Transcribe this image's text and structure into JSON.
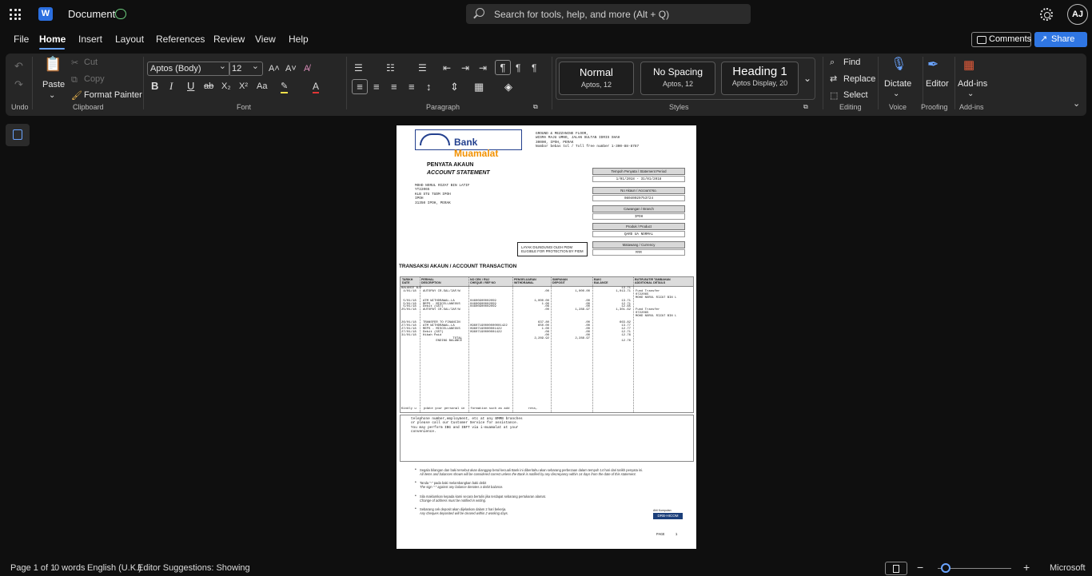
{
  "titlebar": {
    "doc_title": "Document",
    "search_placeholder": "Search for tools, help, and more (Alt + Q)",
    "avatar_initials": "AJ"
  },
  "menu": {
    "items": [
      "File",
      "Home",
      "Insert",
      "Layout",
      "References",
      "Review",
      "View",
      "Help"
    ],
    "active": "Home",
    "comments": "Comments",
    "share": "Share"
  },
  "ribbon": {
    "clipboard": {
      "paste": "Paste",
      "cut": "Cut",
      "copy": "Copy",
      "format_painter": "Format Painter",
      "label": "Clipboard"
    },
    "undo_label": "Undo",
    "font": {
      "name": "Aptos (Body)",
      "size": "12",
      "label": "Font"
    },
    "paragraph_label": "Paragraph",
    "styles": {
      "label": "Styles",
      "cards": [
        {
          "name": "Normal",
          "sub": "Aptos, 12"
        },
        {
          "name": "No Spacing",
          "sub": "Aptos, 12"
        },
        {
          "name": "Heading 1",
          "sub": "Aptos Display, 20"
        }
      ]
    },
    "editing": {
      "find": "Find",
      "replace": "Replace",
      "select": "Select",
      "label": "Editing"
    },
    "voice": {
      "dictate": "Dictate",
      "label": "Voice"
    },
    "proofing": {
      "editor": "Editor",
      "label": "Proofing"
    },
    "addins": {
      "addins": "Add-ins",
      "label": "Add-ins"
    }
  },
  "document": {
    "logo_text": "Bank Muamalat",
    "bank_address": "GROUND & MEZZANINE FLOOR,\nWISMA MAJU UMNO, JALAN SULTAN IDRIS SHAH\n30000, IPOH, PERAK\nNombor bebas tol / Toll free number 1-300-88-8787",
    "statement_title_ms": "PENYATA AKAUN",
    "statement_title_en": "ACCOUNT STATEMENT",
    "customer_address": "MOHD NORUL RIZAT BIN LATIF\nYT22065\nKLB STU TUDM IPOH\nIPOH\n31350 IPOH, PERAK",
    "info_boxes": [
      {
        "label": "Tempoh Penyata / Statement Period",
        "value": "1/01/2018 - 31/01/2018"
      },
      {
        "label": "No Akaun / Account No.",
        "value": "08040029753724"
      },
      {
        "label": "Cawangan / Branch",
        "value": "IPOH"
      },
      {
        "label": "Produk / Product",
        "value": "QARD UA NORMAL"
      },
      {
        "label": "Matawang / Currency",
        "value": "MYR"
      }
    ],
    "pidm_text": "LAYAK DILINDUNGI OLEH PIDM\nELIGIBLE FOR PROTECTION BY PIDM",
    "tx_title": "TRANSAKSI AKAUN / ACCOUNT TRANSACTION",
    "tx_headers": [
      "TARIKH\nDATE",
      "PERIHAL\nDESCRIPTION",
      "NO CEK / RUJ\nCHEQUE / REF NO",
      "PENGELUARAN\nWITHDRAWAL",
      "SIMPANAN\nDEPOSIT",
      "BAKI\nBALANCE",
      "BUTIR-BUTIR TAMBAHAN\nADDITIONAL DETAILS"
    ],
    "tx_dates": "BALANCE B/F\n 4/01/18\n\n\n 5/01/18\n 5/01/18\n 5/01/18\n25/01/18\n\n\n\n26/01/18\n27/01/18\n27/01/18\n27/01/18\n31/01/18",
    "tx_desc": "\nAUTOPAY CR-SAL/IAF/W\n\n\nATM WITHDRAWAL-LA\nMEPS - MISCELLANEOUS\nDebit (GST)\nAUTOPAY CR-SAL/IAF/W\n\n\n\nTRANSFER TO FINANCIN\nATM WITHDRAWAL-LA\nMEPS - MISCELLANEOUS\nDebit (GST)\nHibah Paid\n                TOTAL\n       ENDING BALANCE",
    "tx_ref": "\n\n\n\n04600900002059\n04600900002059\n04600900002059\n\n\n\n\n\n09607190000000001422\n09607190000001422\n09607190000001422",
    "tx_withdrawal": "\n.00\n\n\n1,000.00\n1.00\n.06\n.00\n\n\n\n637.80\n650.00\n1.00\n.06\n.00\n2,289.92",
    "tx_deposit": "\n1,000.00\n\n\n.00\n.00\n.00\n1,288.97\n\n\n\n.00\n.00\n.00\n.00\n.00\n2,288.97",
    "tx_balance": "13.71\n1,013.71\n\n\n13.71\n12.71\n12.65\n1,301.62\n\n\n\n663.82\n13.77\n12.77\n12.71\n12.76\n\n12.76",
    "tx_details": "\nFund Transfer\n0722065\nMOHD NORUL RIZAT BIN L\n\n\n\nFund Transfer\n0722065\nMOHD NORUL RIZAT BIN L",
    "tx_footer": "Kindly u    pdate your personal in   formation such as add          ress,",
    "notice_text": "telephone number,employment, etc at any BMMB branches\nor please call our Customer Service for assistance.\nYou may perform IBG and IBFT via i-muamalat at your\nconvenience.",
    "bullets": [
      {
        "ms": "Segala bilangan dan baki tersebut akan dianggap betul kecuali Bank ini diberitahu akan sebarang perbezaan dalam tempoh 14 hari dari tarikh penyata ini.",
        "en": "All items and balances shown will be considered correct unless the Bank is notified by any discrepancy within 14 days from the date of this statement."
      },
      {
        "ms": "Tanda \"-\" pada baki melambangkan baki debit",
        "en": "The sign \"-\" against any balance denotes a debit balance."
      },
      {
        "ms": "Sila maklumkan kepada kami secara bertulis jika terdapat sebarang pertukaran alamat.",
        "en": "Change of address must be notified in writing."
      },
      {
        "ms": "Sebarang cek deposit akan dijelaskan dalam 2 hari bekerja.",
        "en": "Any cheques deposited will be cleared within 2 working days."
      }
    ],
    "group_caption": "DRB-HICOM",
    "group_small": "Ahli Kumpulan",
    "page_label": "PAGE     1"
  },
  "status": {
    "page": "Page 1 of 1",
    "words": "0 words",
    "language": "English (U.K.)",
    "editor": "Editor Suggestions: Showing",
    "brand": "Microsoft"
  },
  "colors": {
    "accent": "#2f76e3",
    "bank_blue": "#23408e",
    "bank_orange": "#f29100"
  },
  "icons": [
    "waffle-icon",
    "word-icon",
    "save-status-icon",
    "search-icon",
    "settings-icon",
    "comment-icon",
    "share-icon"
  ],
  "zoom_level": 0.05
}
